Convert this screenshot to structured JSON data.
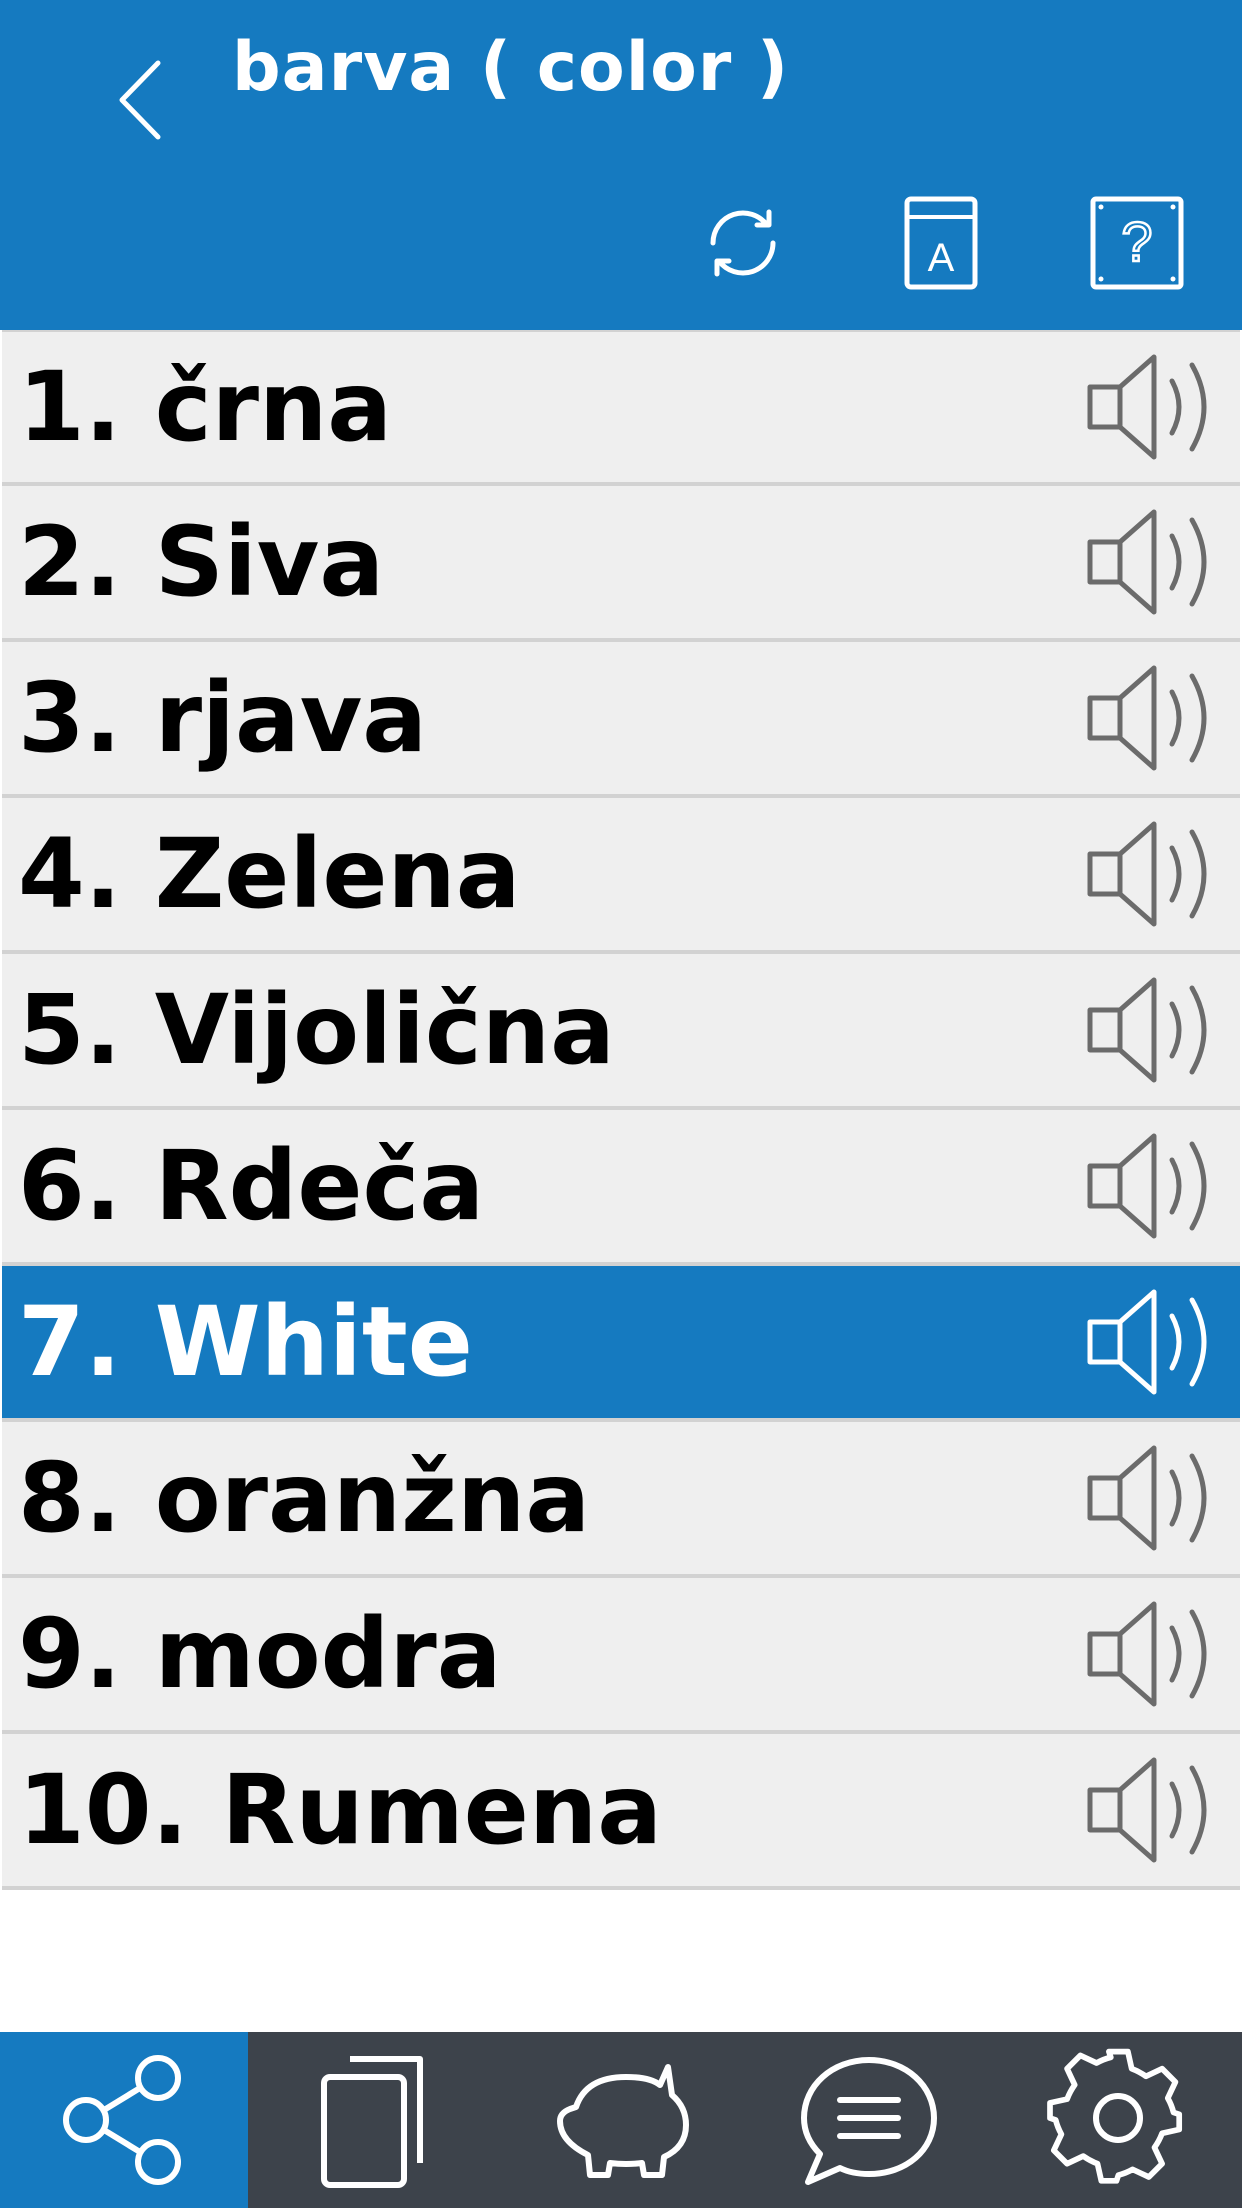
{
  "header": {
    "title": "barva ( color )",
    "back_icon": "chevron-left-icon",
    "actions": [
      {
        "name": "refresh-icon"
      },
      {
        "name": "dictionary-book-icon",
        "letter": "A"
      },
      {
        "name": "help-icon",
        "symbol": "?"
      }
    ]
  },
  "list": {
    "items": [
      {
        "label": "1. črna"
      },
      {
        "label": "2. Siva"
      },
      {
        "label": "3. rjava"
      },
      {
        "label": "4. Zelena"
      },
      {
        "label": "5. Vijolična"
      },
      {
        "label": "6. Rdeča"
      },
      {
        "label": "7. White"
      },
      {
        "label": "8. oranžna"
      },
      {
        "label": "9. modra"
      },
      {
        "label": "10. Rumena"
      }
    ],
    "selected_index": 6,
    "row_icon": "speaker-icon"
  },
  "bottom_nav": {
    "tabs": [
      {
        "icon": "share-icon"
      },
      {
        "icon": "cards-icon"
      },
      {
        "icon": "piggy-bank-icon"
      },
      {
        "icon": "chat-bubble-icon"
      },
      {
        "icon": "gear-icon"
      }
    ],
    "active_index": 0
  },
  "colors": {
    "primary": "#157ac0",
    "row_background": "#efefef",
    "row_divider": "#d2d2d2",
    "bottom_bar": "#3d434b",
    "icon_gray": "#6b6b6b"
  }
}
